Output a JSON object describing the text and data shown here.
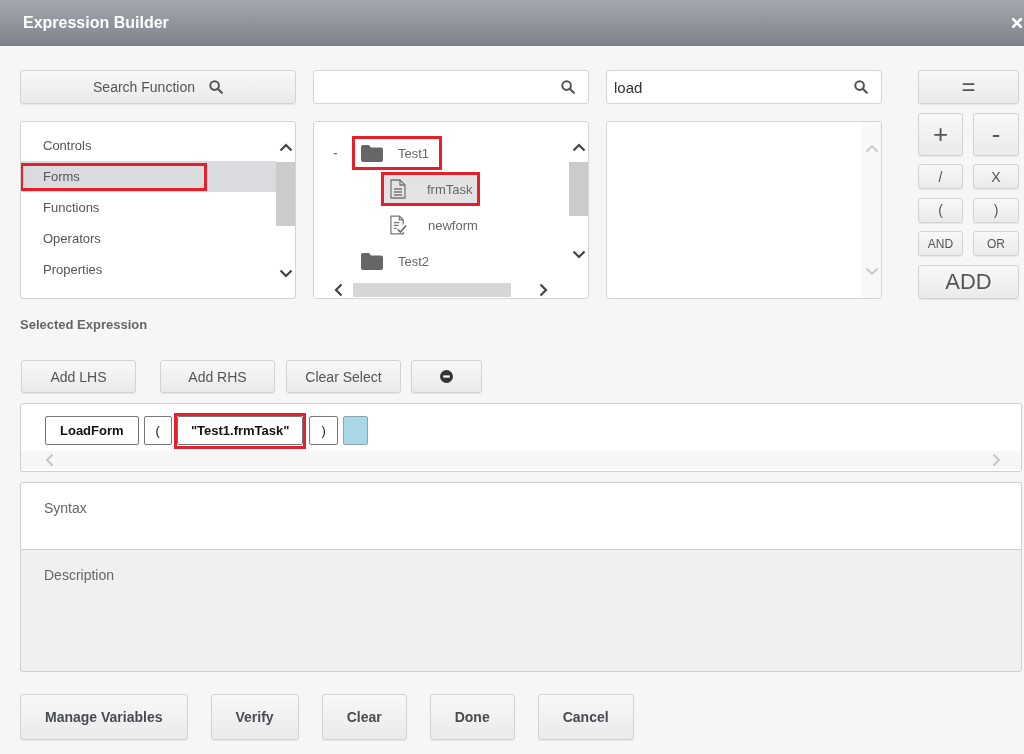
{
  "window": {
    "title": "Expression Builder"
  },
  "search_function_button": {
    "label": "Search Function"
  },
  "function_search": {
    "value": "load"
  },
  "categories": [
    {
      "label": "Controls",
      "selected": false,
      "highlighted": false
    },
    {
      "label": "Forms",
      "selected": true,
      "highlighted": true
    },
    {
      "label": "Functions",
      "selected": false,
      "highlighted": false
    },
    {
      "label": "Operators",
      "selected": false,
      "highlighted": false
    },
    {
      "label": "Properties",
      "selected": false,
      "highlighted": false
    }
  ],
  "tree": [
    {
      "label": "Test1",
      "kind": "folder",
      "toggle": "-",
      "selected": false,
      "highlighted": true,
      "children": [
        {
          "label": "frmTask",
          "kind": "document",
          "selected": true,
          "highlighted": true
        },
        {
          "label": "newform",
          "kind": "form",
          "selected": false,
          "highlighted": false
        }
      ]
    },
    {
      "label": "Test2",
      "kind": "folder",
      "selected": false,
      "highlighted": false
    }
  ],
  "operators": [
    {
      "label": "=",
      "kind": "wide"
    },
    {
      "label": "+",
      "kind": "large"
    },
    {
      "label": "-",
      "kind": "large"
    },
    {
      "label": "/",
      "kind": "small"
    },
    {
      "label": "X",
      "kind": "small"
    },
    {
      "label": "(",
      "kind": "small"
    },
    {
      "label": ")",
      "kind": "small"
    },
    {
      "label": "AND",
      "kind": "word"
    },
    {
      "label": "OR",
      "kind": "word"
    },
    {
      "label": "ADD",
      "kind": "add"
    }
  ],
  "selected_expression": {
    "title": "Selected Expression",
    "buttons": [
      {
        "kind": "text",
        "label": "Add LHS"
      },
      {
        "kind": "text",
        "label": "Add RHS"
      },
      {
        "kind": "text",
        "label": "Clear Select"
      },
      {
        "kind": "remove"
      }
    ],
    "tokens": [
      {
        "kind": "function",
        "text": "LoadForm",
        "highlighted": false
      },
      {
        "kind": "paren",
        "text": "(",
        "highlighted": false
      },
      {
        "kind": "argument",
        "text": "\"Test1.frmTask\"",
        "highlighted": true
      },
      {
        "kind": "paren",
        "text": ")",
        "highlighted": false
      },
      {
        "kind": "slot",
        "highlighted": false
      }
    ]
  },
  "syntax": {
    "title": "Syntax"
  },
  "description": {
    "title": "Description"
  },
  "footer_buttons": [
    {
      "label": "Manage Variables"
    },
    {
      "label": "Verify"
    },
    {
      "label": "Clear"
    },
    {
      "label": "Done"
    },
    {
      "label": "Cancel"
    }
  ]
}
